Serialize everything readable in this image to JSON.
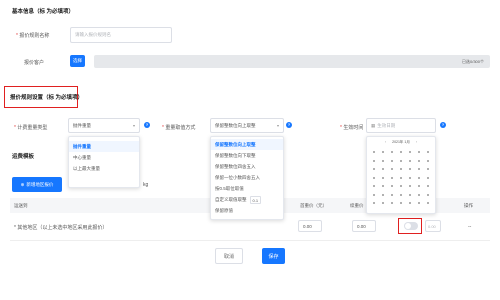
{
  "basic": {
    "title": "基本信息（标 为必填项）",
    "name_label": "报价规则名称",
    "name_placeholder": "请输入报价规则名",
    "customer_label": "报价客户",
    "customer_button": "选择",
    "customer_note": "已选0/300个"
  },
  "rule": {
    "title": "报价规则设置（标 为必填项）",
    "weight_type_label": "计费重量类型",
    "weight_type_value": "抛件重量",
    "rounding_label": "重量取值方式",
    "rounding_value": "保留整数位向上取整",
    "effective_label": "生效时间",
    "effective_placeholder": "生效日期"
  },
  "weight_dropdown": {
    "items": [
      "抛件重量",
      "中心重量",
      "以上最大重量"
    ],
    "selected": 0
  },
  "rounding_dropdown": {
    "items": [
      "保留整数位向上取整",
      "保留整数位向下取整",
      "保留整数位四舍五入",
      "保留一位小数四舍五入",
      "按0.5取位取值",
      "自定义取值取整",
      "保留原值"
    ],
    "selected": 0,
    "custom_value": "0.1"
  },
  "calendar": {
    "header": "2021年 1月"
  },
  "freight": {
    "title": "运费模板",
    "add_button": "新增地区报价",
    "unit_hint": "kg",
    "columns": {
      "destination": "运送到",
      "first_weight_price": "首重价（元）",
      "continue_weight_price": "续重价（元）",
      "price": "价",
      "actions": "操作"
    },
    "row": {
      "destination": "* 其他地区（以上未选中地区采用此报价）",
      "first_price": "0.00",
      "continue_price": "0.00",
      "extra": "0.00",
      "action": "--"
    }
  },
  "footer": {
    "cancel": "取消",
    "save": "保存"
  },
  "colors": {
    "primary": "#1677ff",
    "highlight": "#e02020"
  }
}
